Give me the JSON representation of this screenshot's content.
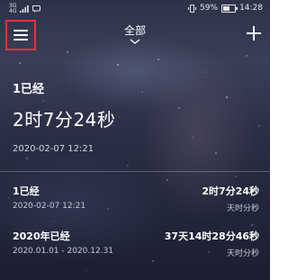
{
  "status_bar": {
    "network_top": "3G",
    "network_bottom": "4G",
    "battery_percent": "59%",
    "battery_level": 0.59,
    "time": "14:28"
  },
  "header": {
    "filter_label": "全部"
  },
  "featured": {
    "title": "1已经",
    "elapsed": "2时7分24秒",
    "date": "2020-02-07 12:21"
  },
  "events": [
    {
      "name": "1已经",
      "value": "2时7分24秒",
      "date": "2020-02-07 12:21",
      "units": "天时分秒"
    },
    {
      "name": "2020年已经",
      "value": "37天14时28分46秒",
      "date": "2020.01.01 - 2020.12.31",
      "units": "天时分秒"
    }
  ],
  "colors": {
    "highlight_border": "#e5323e",
    "text": "#ffffff",
    "secondary_text": "#c9cbd8"
  },
  "icons": {
    "menu": "hamburger-icon",
    "filter": "chevron-down-icon",
    "add": "plus-icon"
  }
}
